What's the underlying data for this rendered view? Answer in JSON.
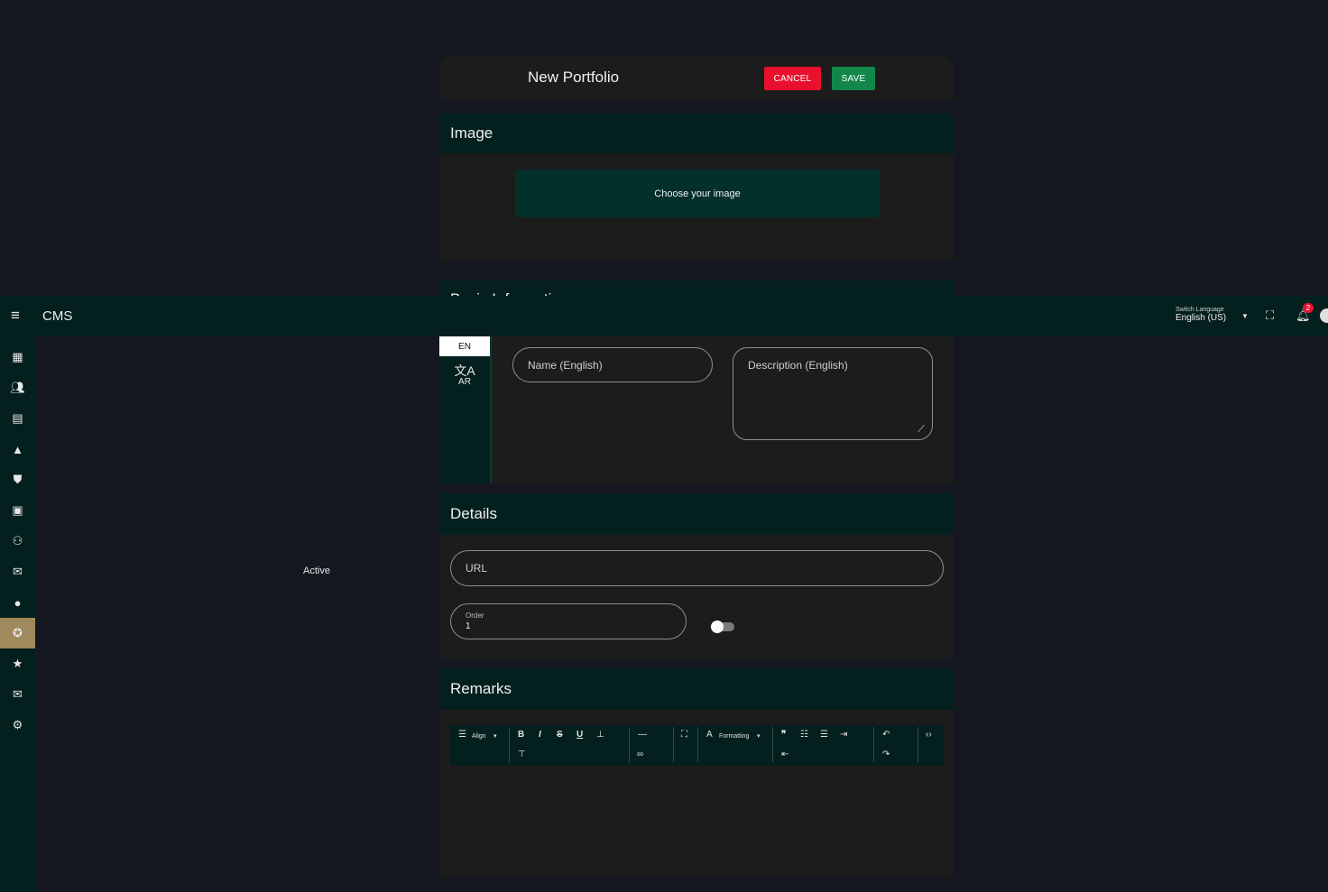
{
  "form": {
    "title": "New Portfolio",
    "cancel_label": "CANCEL",
    "save_label": "SAVE",
    "image": {
      "heading": "Image",
      "choose_label": "Choose your image"
    },
    "basic": {
      "heading": "Basic Information",
      "tabs": [
        {
          "code": "EN",
          "active": true
        },
        {
          "code": "AR",
          "active": false
        }
      ],
      "name_placeholder": "Name (English)",
      "description_placeholder": "Description (English)"
    },
    "details": {
      "heading": "Details",
      "url_placeholder": "URL",
      "order_label": "Order",
      "order_value": "1",
      "active_label": "Active",
      "active_on": false
    },
    "remarks": {
      "heading": "Remarks",
      "align_label": "Align",
      "formatting_label": "Formatting"
    }
  },
  "appbar": {
    "title": "CMS",
    "switch_language_label": "Switch Language",
    "current_language": "English (US)",
    "notification_count": "2"
  },
  "sidebar": {
    "items": [
      {
        "icon": "dashboard-icon"
      },
      {
        "icon": "users-icon"
      },
      {
        "icon": "layout-icon"
      },
      {
        "icon": "shapes-icon"
      },
      {
        "icon": "shield-icon"
      },
      {
        "icon": "post-add-icon"
      },
      {
        "icon": "groups-icon"
      },
      {
        "icon": "feedback-icon"
      },
      {
        "icon": "lightbulb-icon"
      },
      {
        "icon": "award-icon",
        "active": true
      },
      {
        "icon": "star-icon"
      },
      {
        "icon": "mail-icon"
      },
      {
        "icon": "gear-icon"
      }
    ]
  },
  "colors": {
    "accent_dark": "#04201e",
    "cancel": "#e8112d",
    "save": "#12874a",
    "sidebar_active": "#a0895c"
  }
}
